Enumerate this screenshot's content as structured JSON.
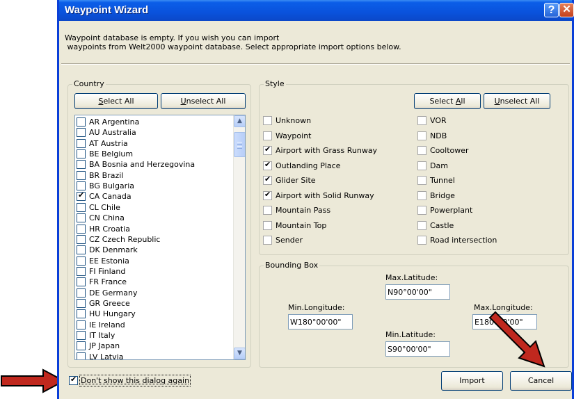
{
  "window": {
    "title": "Waypoint Wizard",
    "help": "?",
    "close": "✕"
  },
  "intro": {
    "line1": "Waypoint database is empty. If you wish you can import",
    "line2": " waypoints from Welt2000 waypoint database. Select appropriate import options below."
  },
  "country": {
    "legend": "Country",
    "select_all": {
      "pre": "",
      "key": "S",
      "post": "elect All"
    },
    "unselect_all": {
      "pre": "",
      "key": "U",
      "post": "nselect All"
    },
    "items": [
      {
        "label": "AR Argentina",
        "checked": false
      },
      {
        "label": "AU Australia",
        "checked": false
      },
      {
        "label": "AT Austria",
        "checked": false
      },
      {
        "label": "BE Belgium",
        "checked": false
      },
      {
        "label": "BA Bosnia and Herzegovina",
        "checked": false
      },
      {
        "label": "BR Brazil",
        "checked": false
      },
      {
        "label": "BG Bulgaria",
        "checked": false
      },
      {
        "label": "CA Canada",
        "checked": true
      },
      {
        "label": "CL Chile",
        "checked": false
      },
      {
        "label": "CN China",
        "checked": false
      },
      {
        "label": "HR Croatia",
        "checked": false
      },
      {
        "label": "CZ Czech Republic",
        "checked": false
      },
      {
        "label": "DK Denmark",
        "checked": false
      },
      {
        "label": "EE Estonia",
        "checked": false
      },
      {
        "label": "FI Finland",
        "checked": false
      },
      {
        "label": "FR France",
        "checked": false
      },
      {
        "label": "DE Germany",
        "checked": false
      },
      {
        "label": "GR Greece",
        "checked": false
      },
      {
        "label": "HU Hungary",
        "checked": false
      },
      {
        "label": "IE Ireland",
        "checked": false
      },
      {
        "label": "IT Italy",
        "checked": false
      },
      {
        "label": "JP Japan",
        "checked": false
      },
      {
        "label": "LV Latvia",
        "checked": false
      }
    ]
  },
  "style": {
    "legend": "Style",
    "select_all": {
      "pre": "Select ",
      "key": "A",
      "post": "ll"
    },
    "unselect_all": {
      "pre": "",
      "key": "U",
      "post": "nselect All"
    },
    "left": [
      {
        "label": "Unknown",
        "checked": false
      },
      {
        "label": "Waypoint",
        "checked": false
      },
      {
        "label": "Airport with Grass Runway",
        "checked": true
      },
      {
        "label": "Outlanding Place",
        "checked": true
      },
      {
        "label": "Glider Site",
        "checked": true
      },
      {
        "label": "Airport with Solid Runway",
        "checked": true
      },
      {
        "label": "Mountain Pass",
        "checked": false
      },
      {
        "label": "Mountain Top",
        "checked": false
      },
      {
        "label": "Sender",
        "checked": false
      }
    ],
    "right": [
      {
        "label": "VOR",
        "checked": false
      },
      {
        "label": "NDB",
        "checked": false
      },
      {
        "label": "Cooltower",
        "checked": false
      },
      {
        "label": "Dam",
        "checked": false
      },
      {
        "label": "Tunnel",
        "checked": false
      },
      {
        "label": "Bridge",
        "checked": false
      },
      {
        "label": "Powerplant",
        "checked": false
      },
      {
        "label": "Castle",
        "checked": false
      },
      {
        "label": "Road intersection",
        "checked": false
      }
    ]
  },
  "bbox": {
    "legend": "Bounding Box",
    "max_lat_label": "Max.Latitude:",
    "max_lat": "N90°00'00\"",
    "min_lon_label": "Min.Longitude:",
    "min_lon": "W180°00'00\"",
    "max_lon_label": "Max.Longitude:",
    "max_lon": "E180°00'00\"",
    "min_lat_label": "Min.Latitude:",
    "min_lat": "S90°00'00\""
  },
  "footer": {
    "dont_show_label": "Don't show this dialog again",
    "dont_show_checked": true,
    "import": "Import",
    "cancel": "Cancel"
  },
  "colors": {
    "titlebar": "#0a52dc",
    "arrow": "#c0281e",
    "dialog_bg": "#ece9d8"
  }
}
